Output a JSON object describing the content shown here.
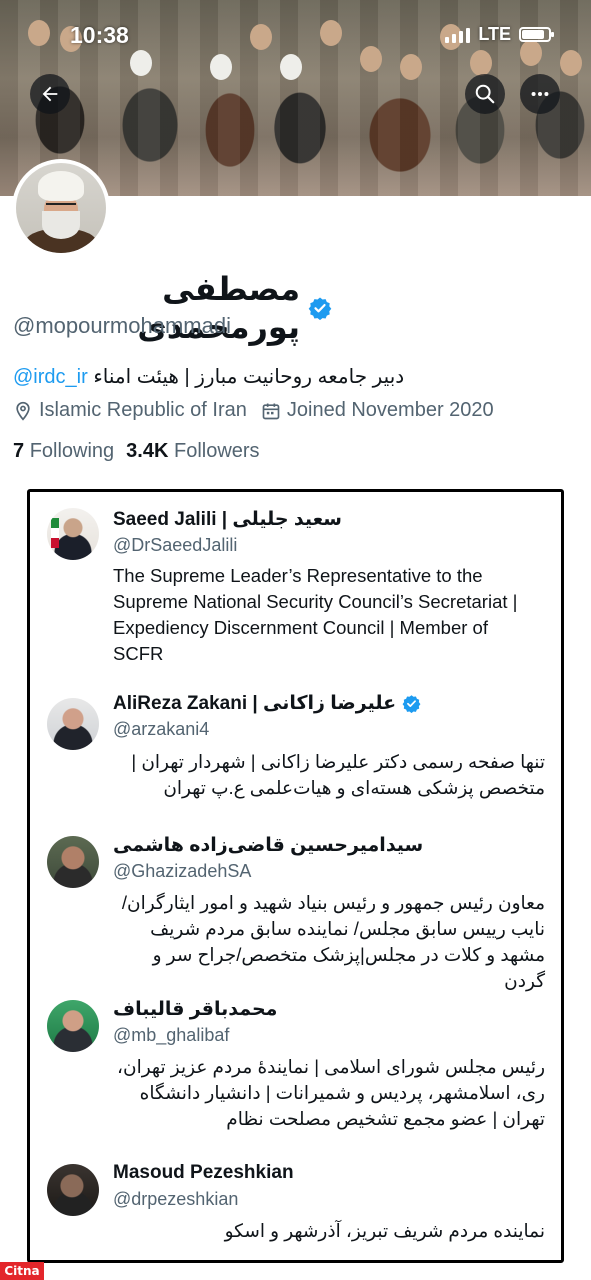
{
  "status_bar": {
    "time": "10:38",
    "network": "LTE"
  },
  "profile": {
    "name": "مصطفی پورمحمدی",
    "handle": "@mopourmohammadi",
    "bio_link": "@irdc_ir",
    "bio_text": "دبیر جامعه روحانیت مبارز | هیئت امناء",
    "location": "Islamic Republic of Iran",
    "joined": "Joined November 2020",
    "following_count": "7",
    "following_label": "Following",
    "followers_count": "3.4K",
    "followers_label": "Followers"
  },
  "accounts": [
    {
      "name": "Saeed Jalili | سعید جلیلی",
      "handle": "@DrSaeedJalili",
      "verified": false,
      "desc": "The Supreme Leader’s Representative to the Supreme National Security Council’s Secretariat | Expediency Discernment Council | Member of SCFR"
    },
    {
      "name": "AliReza Zakani | علیرضا زاکانی",
      "handle": "@arzakani4",
      "verified": true,
      "desc": "تنها صفحه رسمی دکتر علیرضا زاکانی | شهردار تهران | متخصص پزشکی هسته‌ای و هیات‌علمی ع.پ تهران"
    },
    {
      "name": "سیدامیرحسین قاضی‌زاده هاشمی",
      "handle": "@GhazizadehSA",
      "verified": false,
      "desc": "معاون رئیس جمهور و رئیس بنیاد شهید و امور ایثارگران/ نایب رییس سابق مجلس/ نماینده سابق مردم شریف مشهد و کلات در مجلس|پزشک متخصص/جراح سر و گردن"
    },
    {
      "name": "محمدباقر قالیباف",
      "handle": "@mb_ghalibaf",
      "verified": false,
      "desc": "رئیس مجلس شورای اسلامی | نمایندهٔ مردم عزیز تهران، ری، اسلامشهر، پردیس و شمیرانات | دانشیار دانشگاه تهران | عضو مجمع تشخیص مصلحت نظام"
    },
    {
      "name": "Masoud Pezeshkian",
      "handle": "@drpezeshkian",
      "verified": false,
      "desc": "نماینده مردم شریف تبریز، آذرشهر و اسکو"
    }
  ],
  "watermark": "Citna",
  "colors": {
    "accent": "#1d9bf0",
    "muted": "#536471",
    "text": "#0f1419"
  }
}
